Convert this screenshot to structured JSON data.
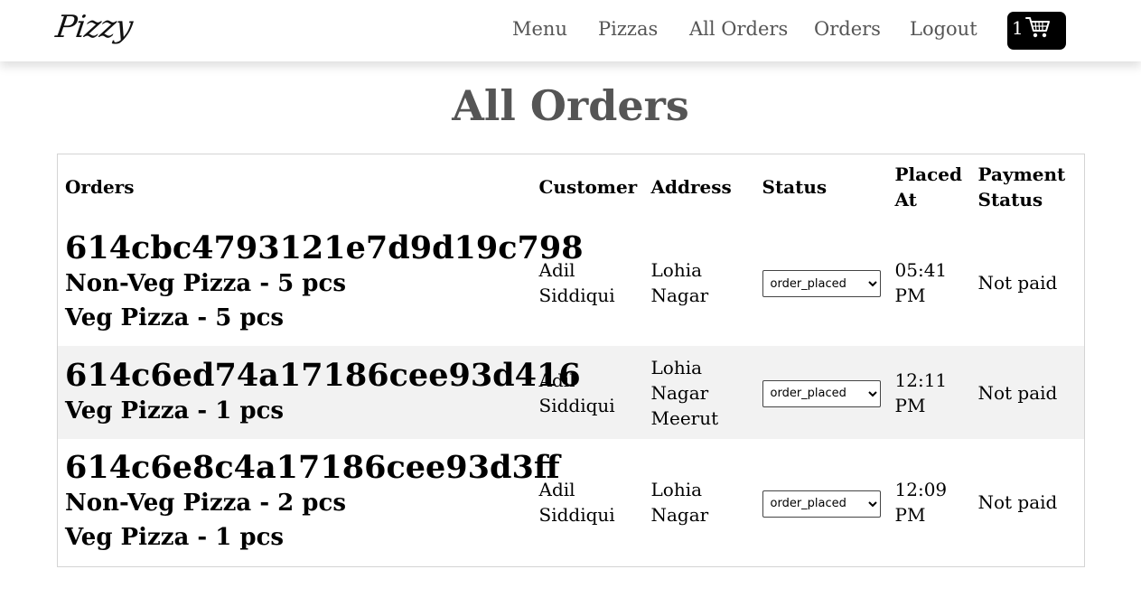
{
  "nav": {
    "logo": "Pizzy",
    "links": [
      "Menu",
      "Pizzas",
      "All Orders",
      "Orders",
      "Logout"
    ],
    "cart_count": "1"
  },
  "page": {
    "title": "All Orders"
  },
  "table": {
    "headers": {
      "orders": "Orders",
      "customer": "Customer",
      "address": "Address",
      "status": "Status",
      "placed_at": "Placed At",
      "payment_status": "Payment Status"
    },
    "rows": [
      {
        "order_id": "614cbc4793121e7d9d19c798",
        "items": [
          "Non-Veg Pizza - 5 pcs",
          "Veg Pizza - 5 pcs"
        ],
        "customer": "Adil Siddiqui",
        "address": "Lohia Nagar",
        "status": "order_placed",
        "placed_at": "05:41 PM",
        "payment_status": "Not paid"
      },
      {
        "order_id": "614c6ed74a17186cee93d416",
        "items": [
          "Veg Pizza - 1 pcs"
        ],
        "customer": "Adil Siddiqui",
        "address": "Lohia Nagar Meerut",
        "status": "order_placed",
        "placed_at": "12:11 PM",
        "payment_status": "Not paid"
      },
      {
        "order_id": "614c6e8c4a17186cee93d3ff",
        "items": [
          "Non-Veg Pizza - 2 pcs",
          "Veg Pizza - 1 pcs"
        ],
        "customer": "Adil Siddiqui",
        "address": "Lohia Nagar",
        "status": "order_placed",
        "placed_at": "12:09 PM",
        "payment_status": "Not paid"
      }
    ]
  },
  "icons": {
    "cart": "shopping-cart-icon"
  },
  "colors": {
    "nav_link": "#555555",
    "title": "#555555",
    "cart_bg": "#000000",
    "row_stripe": "#f2f2f2",
    "table_border": "#d4d4d4"
  }
}
